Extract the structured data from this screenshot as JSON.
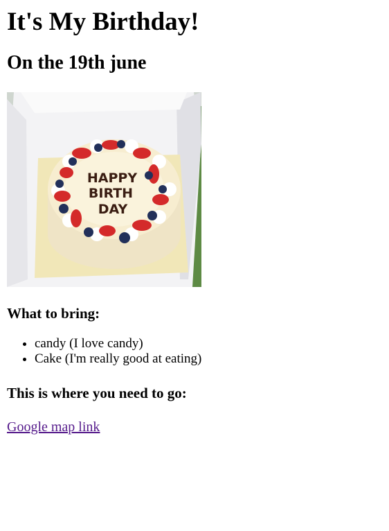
{
  "heading": "It's My Birthday!",
  "subheading": "On the 19th june",
  "cake_image": {
    "cake_text_line1": "HAPPY",
    "cake_text_line2": "BIRTH",
    "cake_text_line3": "DAY"
  },
  "bring": {
    "title": "What to bring:",
    "items": [
      "candy (I love candy)",
      "Cake (I'm really good at eating)"
    ]
  },
  "location": {
    "title": "This is where you need to go:",
    "link_text": "Google map link"
  },
  "colors": {
    "visited_link": "#551a8b",
    "text": "#000000",
    "background": "#ffffff"
  }
}
